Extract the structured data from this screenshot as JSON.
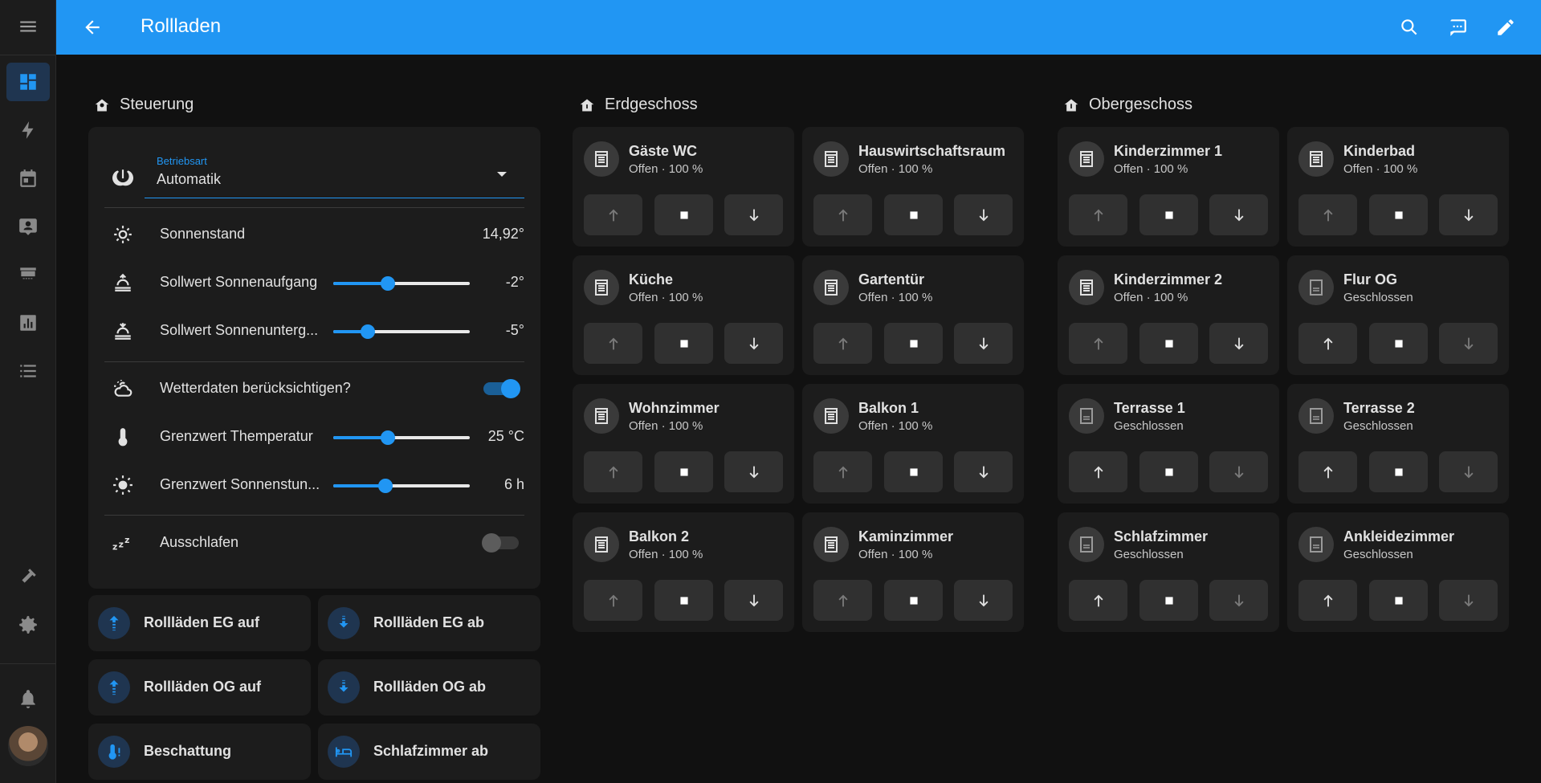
{
  "header": {
    "title": "Rollladen"
  },
  "colors": {
    "accent": "#2196f3",
    "header_bg": "#2196f3",
    "card_bg": "#1c1c1c",
    "page_bg": "#111111"
  },
  "sidebar": {
    "items": [
      {
        "icon": "menu-icon"
      },
      {
        "icon": "dashboard-icon",
        "active": true
      },
      {
        "icon": "energy-icon"
      },
      {
        "icon": "calendar-icon"
      },
      {
        "icon": "person-card-icon"
      },
      {
        "icon": "hacs-store-icon"
      },
      {
        "icon": "chart-box-icon"
      },
      {
        "icon": "list-icon"
      },
      {
        "icon": "hammer-icon"
      },
      {
        "icon": "gear-icon"
      },
      {
        "icon": "bell-icon"
      }
    ]
  },
  "controls": {
    "section_title": "Steuerung",
    "mode": {
      "caption": "Betriebsart",
      "value": "Automatik"
    },
    "rows": [
      {
        "label": "Sonnenstand",
        "value": "14,92°"
      },
      {
        "label": "Sollwert Sonnenaufgang",
        "value": "-2°",
        "slider": 0.4
      },
      {
        "label": "Sollwert Sonnenunterg...",
        "value": "-5°",
        "slider": 0.25
      },
      {
        "label": "Wetterdaten berücksichtigen?",
        "toggle": true
      },
      {
        "label": "Grenzwert Themperatur",
        "value": "25 °C",
        "slider": 0.4
      },
      {
        "label": "Grenzwert Sonnenstun...",
        "value": "6 h",
        "slider": 0.38
      },
      {
        "label": "Ausschlafen",
        "toggle": false
      }
    ]
  },
  "scripts": [
    {
      "label": "Rollläden EG auf",
      "icon": "arrow-up-bold-lines-icon"
    },
    {
      "label": "Rollläden EG ab",
      "icon": "arrow-down-bold-lines-icon"
    },
    {
      "label": "Rollläden OG auf",
      "icon": "arrow-up-bold-lines-icon"
    },
    {
      "label": "Rollläden OG ab",
      "icon": "arrow-down-bold-lines-icon"
    },
    {
      "label": "Beschattung",
      "icon": "thermometer-alert-icon"
    },
    {
      "label": "Schlafzimmer ab",
      "icon": "bed-icon"
    }
  ],
  "erdgeschoss": {
    "section_title": "Erdgeschoss",
    "tiles": [
      {
        "name": "Gäste WC",
        "state": "Offen · 100 %"
      },
      {
        "name": "Hauswirtschaftsraum",
        "state": "Offen · 100 %"
      },
      {
        "name": "Küche",
        "state": "Offen · 100 %"
      },
      {
        "name": "Gartentür",
        "state": "Offen · 100 %"
      },
      {
        "name": "Wohnzimmer",
        "state": "Offen · 100 %"
      },
      {
        "name": "Balkon 1",
        "state": "Offen · 100 %"
      },
      {
        "name": "Balkon 2",
        "state": "Offen · 100 %"
      },
      {
        "name": "Kaminzimmer",
        "state": "Offen · 100 %"
      }
    ]
  },
  "obergeschoss": {
    "section_title": "Obergeschoss",
    "tiles": [
      {
        "name": "Kinderzimmer 1",
        "state": "Offen · 100 %"
      },
      {
        "name": "Kinderbad",
        "state": "Offen · 100 %"
      },
      {
        "name": "Kinderzimmer 2",
        "state": "Offen · 100 %"
      },
      {
        "name": "Flur OG",
        "state": "Geschlossen"
      },
      {
        "name": "Terrasse 1",
        "state": "Geschlossen"
      },
      {
        "name": "Terrasse 2",
        "state": "Geschlossen"
      },
      {
        "name": "Schlafzimmer",
        "state": "Geschlossen"
      },
      {
        "name": "Ankleidezimmer",
        "state": "Geschlossen"
      }
    ]
  }
}
